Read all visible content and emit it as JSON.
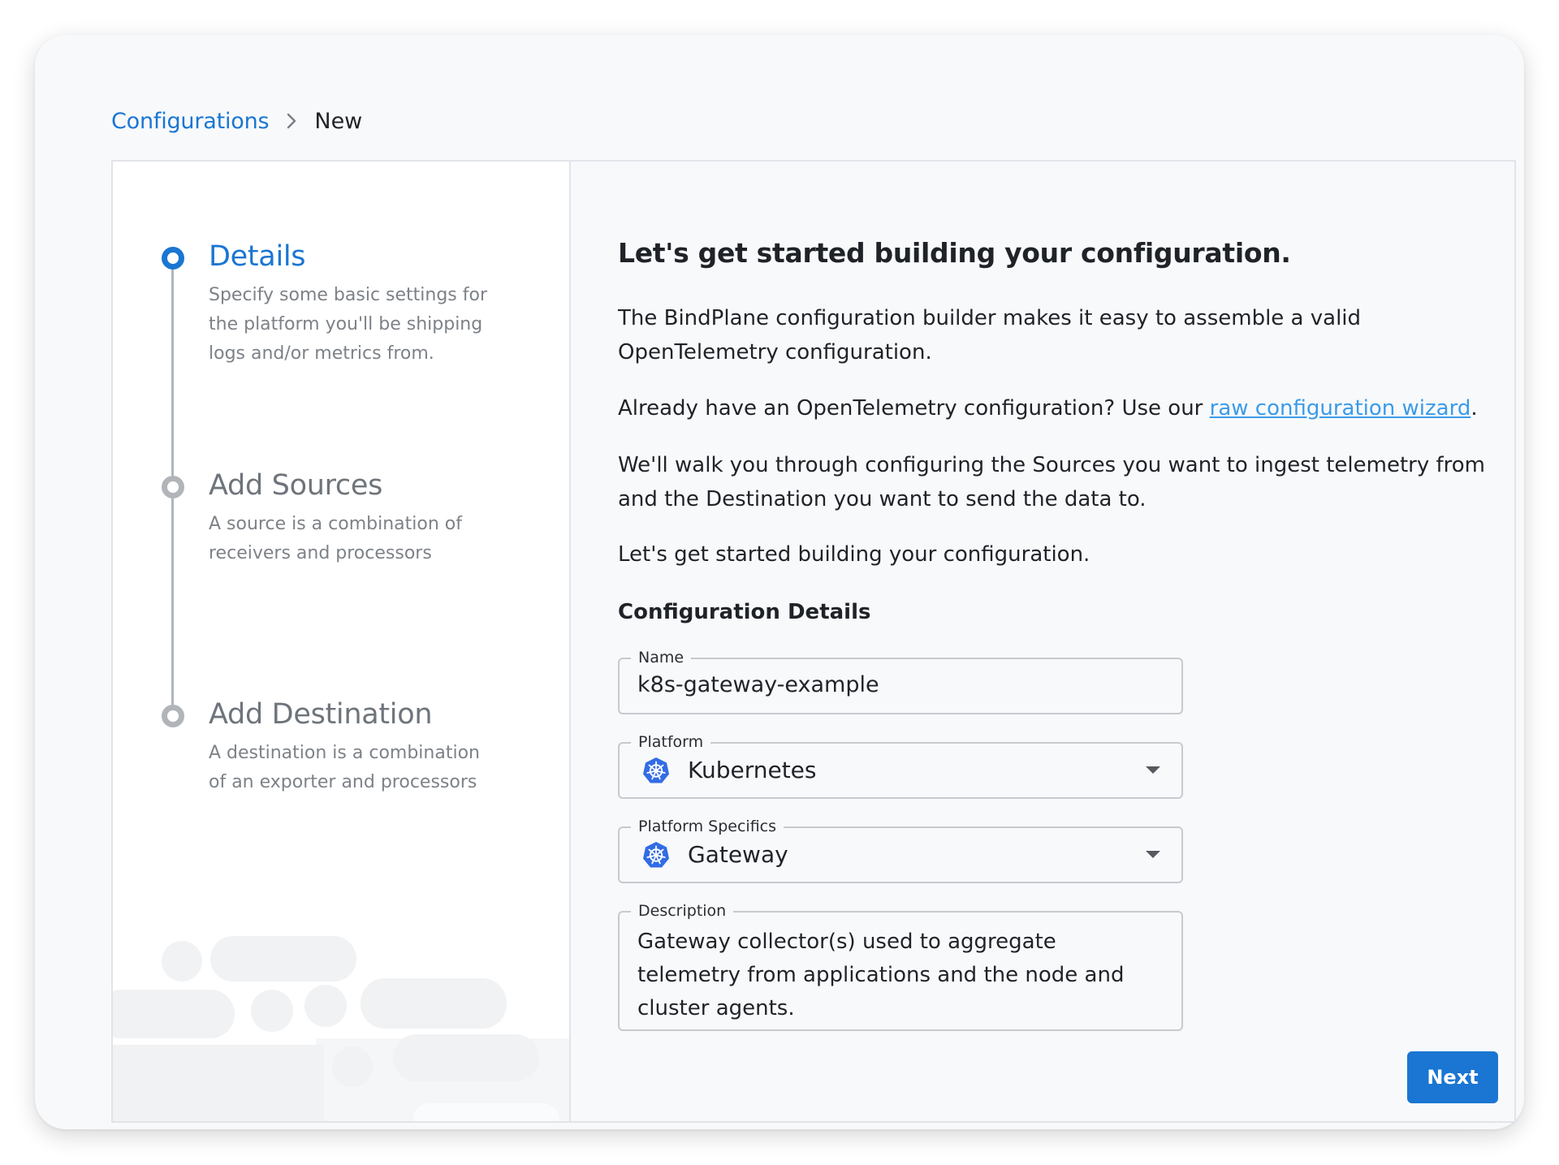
{
  "breadcrumb": {
    "parent": "Configurations",
    "current": "New"
  },
  "steps": [
    {
      "title": "Details",
      "description": "Specify some basic settings for the platform you'll be shipping logs and/or metrics from.",
      "state": "active"
    },
    {
      "title": "Add Sources",
      "description": "A source is a combination of receivers and processors",
      "state": "inactive"
    },
    {
      "title": "Add Destination",
      "description": "A destination is a combination of an exporter and processors",
      "state": "inactive"
    }
  ],
  "intro": {
    "heading": "Let's get started building your configuration.",
    "paragraph1": "The BindPlane configuration builder makes it easy to assemble a valid OpenTelemetry configuration.",
    "paragraph2_prefix": "Already have an OpenTelemetry configuration? Use our ",
    "paragraph2_link": "raw configuration wizard",
    "paragraph2_suffix": ".",
    "paragraph3": "We'll walk you through configuring the Sources you want to ingest telemetry from and the Destination you want to send the data to.",
    "paragraph4": "Let's get started building your configuration."
  },
  "form": {
    "section_title": "Configuration Details",
    "name": {
      "label": "Name",
      "value": "k8s-gateway-example"
    },
    "platform": {
      "label": "Platform",
      "value": "Kubernetes",
      "icon": "kubernetes-icon"
    },
    "platform_specifics": {
      "label": "Platform Specifics",
      "value": "Gateway",
      "icon": "kubernetes-icon"
    },
    "description": {
      "label": "Description",
      "value": "Gateway collector(s) used to aggregate telemetry from applications and the node and cluster agents."
    },
    "next_label": "Next"
  },
  "colors": {
    "accent": "#1a76d2",
    "link": "#3b9be8",
    "inactive": "#b1b5ba"
  }
}
